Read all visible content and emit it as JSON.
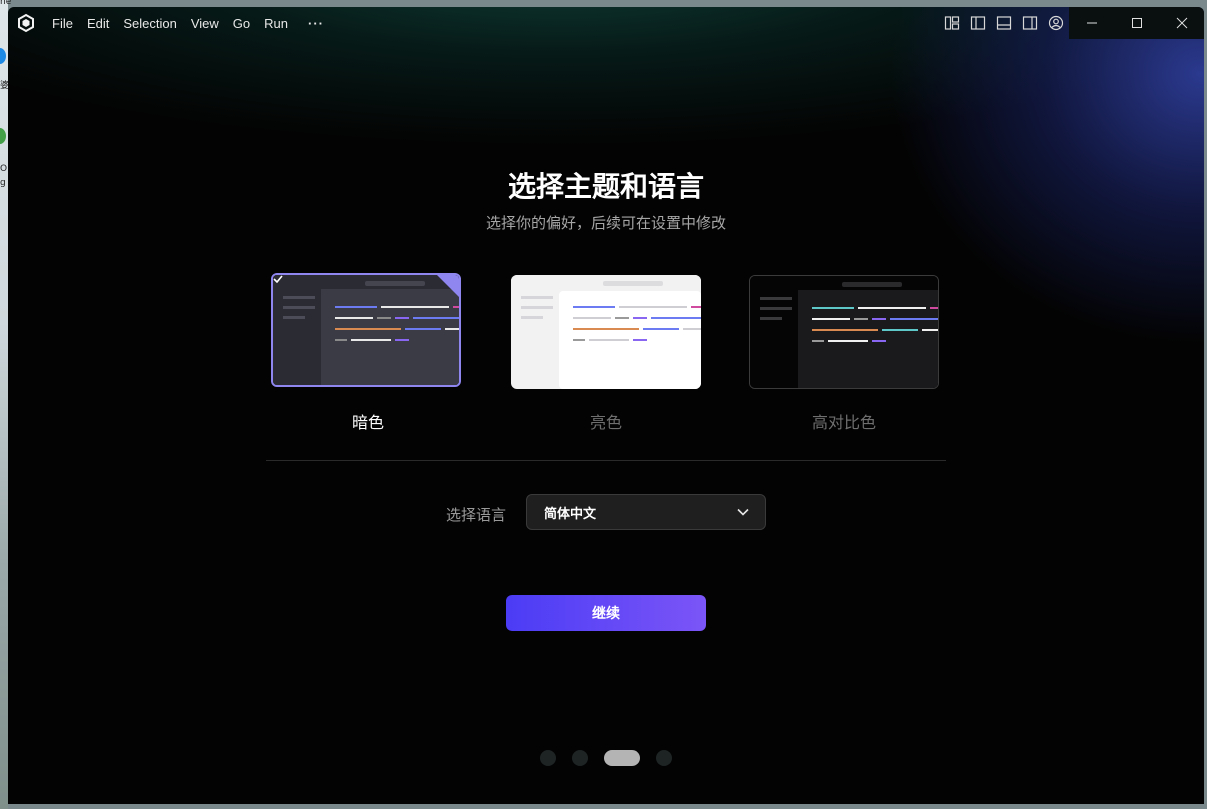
{
  "desktop": {
    "fragments": [
      "ne",
      "婆",
      "O",
      "g"
    ]
  },
  "menu": [
    "File",
    "Edit",
    "Selection",
    "View",
    "Go",
    "Run",
    "···"
  ],
  "icons": [
    "app-logo-icon",
    "layout-customize-icon",
    "toggle-primary-sidebar-icon",
    "toggle-panel-icon",
    "toggle-secondary-sidebar-icon",
    "account-icon",
    "minimize-icon",
    "maximize-icon",
    "close-icon",
    "checkmark-icon",
    "chevron-down-icon"
  ],
  "page": {
    "title": "选择主题和语言",
    "subtitle": "选择你的偏好，后续可在设置中修改"
  },
  "themes": [
    {
      "label": "暗色",
      "selected": true
    },
    {
      "label": "亮色",
      "selected": false
    },
    {
      "label": "高对比色",
      "selected": false
    }
  ],
  "language": {
    "label": "选择语言",
    "selected": "简体中文"
  },
  "continue_label": "继续",
  "pagination": {
    "total": 4,
    "current": 3
  },
  "colors": {
    "accent": "#8f86f0",
    "button_start": "#4b3cf5",
    "button_end": "#7b55f7",
    "background": "#030303"
  }
}
